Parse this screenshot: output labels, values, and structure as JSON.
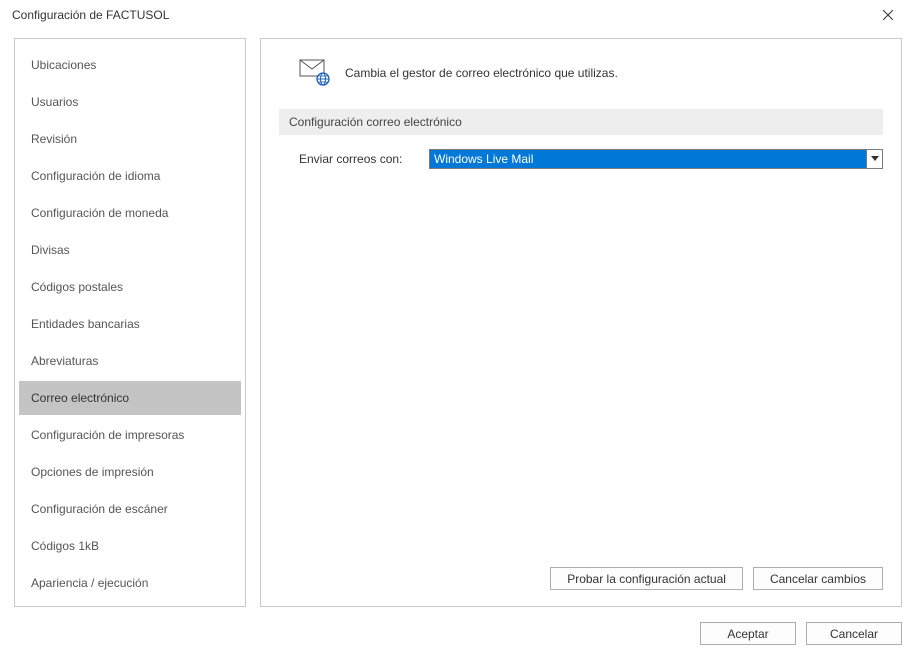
{
  "window": {
    "title": "Configuración de FACTUSOL"
  },
  "sidebar": {
    "items": [
      {
        "label": "Ubicaciones"
      },
      {
        "label": "Usuarios"
      },
      {
        "label": "Revisión"
      },
      {
        "label": "Configuración de idioma"
      },
      {
        "label": "Configuración de moneda"
      },
      {
        "label": "Divisas"
      },
      {
        "label": "Códigos postales"
      },
      {
        "label": "Entidades bancarias"
      },
      {
        "label": "Abreviaturas"
      },
      {
        "label": "Correo electrónico"
      },
      {
        "label": "Configuración de impresoras"
      },
      {
        "label": "Opciones de impresión"
      },
      {
        "label": "Configuración de escáner"
      },
      {
        "label": "Códigos 1kB"
      },
      {
        "label": "Apariencia / ejecución"
      }
    ],
    "selected_index": 9
  },
  "main": {
    "description": "Cambia el gestor de correo electrónico que utilizas.",
    "section_title": "Configuración correo electrónico",
    "send_with_label": "Enviar correos con:",
    "send_with_value": "Windows Live Mail",
    "test_button": "Probar la configuración actual",
    "cancel_changes_button": "Cancelar cambios"
  },
  "dialog": {
    "accept": "Aceptar",
    "cancel": "Cancelar"
  }
}
